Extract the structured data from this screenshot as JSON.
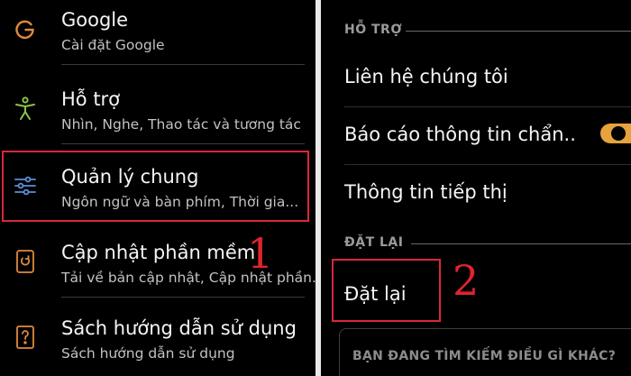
{
  "left_menu": {
    "items": [
      {
        "icon": "google-icon",
        "title": "Google",
        "subtitle": "Cài đặt Google"
      },
      {
        "icon": "accessibility-icon",
        "title": "Hỗ trợ",
        "subtitle": "Nhìn, Nghe, Thao tác và tương tác"
      },
      {
        "icon": "sliders-icon",
        "title": "Quản lý chung",
        "subtitle": "Ngôn ngữ và bàn phím, Thời gia..."
      },
      {
        "icon": "software-update-icon",
        "title": "Cập nhật phần mềm",
        "subtitle": "Tải về bản cập nhật, Cập nhật phần..."
      },
      {
        "icon": "manual-icon",
        "title": "Sách hướng dẫn sử dụng",
        "subtitle": "Sách hướng dẫn sử dụng"
      }
    ],
    "step_label": "1"
  },
  "right_panel": {
    "support_section": {
      "header": "HỖ TRỢ",
      "items": [
        "Liên hệ chúng tôi",
        "Báo cáo thông tin chẩn..",
        "Thông tin tiếp thị"
      ]
    },
    "reset_section": {
      "header": "ĐẶT LẠI",
      "item": "Đặt lại"
    },
    "step_label": "2",
    "search_prompt": "BẠN ĐANG TÌM KIẾM ĐIỀU GÌ KHÁC?",
    "diagnostic_toggle_on": true
  },
  "colors": {
    "highlight": "#d8283a",
    "step_number": "#e0232e",
    "toggle": "#e6a23c",
    "icon_orange": "#e08a3c",
    "icon_green": "#8bc34a",
    "icon_blue": "#5c8fd6"
  }
}
